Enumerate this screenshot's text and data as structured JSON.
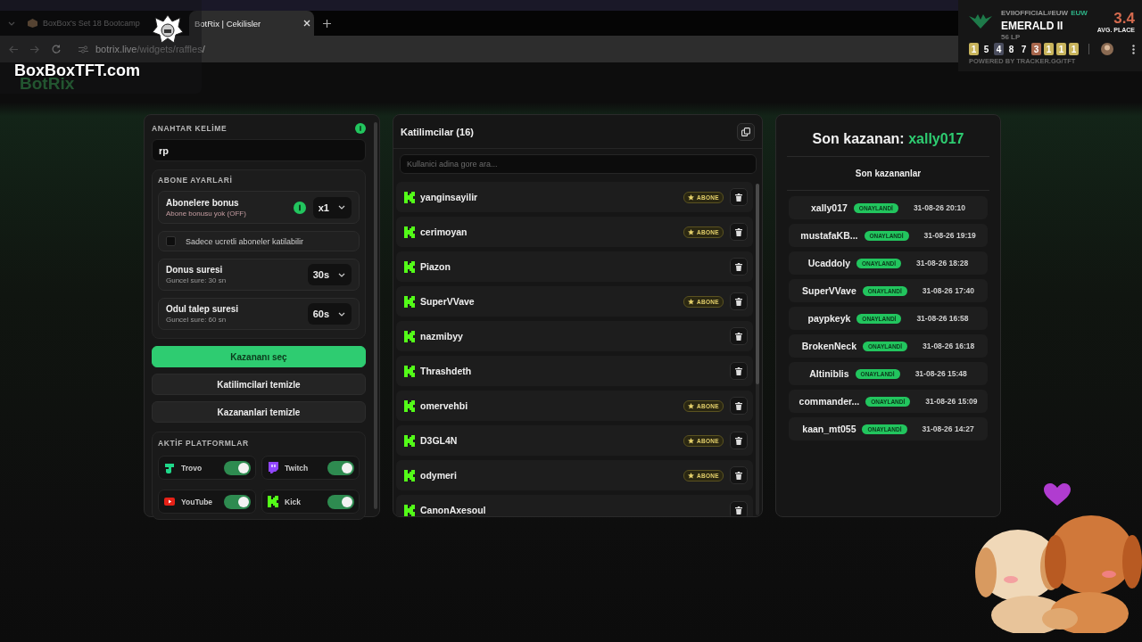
{
  "browser": {
    "tabs": [
      {
        "title": "BoxBox's Set 18 Bootcamp",
        "selected": false
      },
      {
        "title": "BotRix | Cekilisler",
        "selected": true
      }
    ],
    "url_host": "botrix.live",
    "url_path": "/widgets/raffles/"
  },
  "stream_overlay": {
    "site": "BoxBoxTFT.com"
  },
  "rank_widget": {
    "player": "EVIIOFFICIAL#EUW",
    "region": "EUW",
    "rank": "EMERALD II",
    "lp": "56 LP",
    "avg": "3.4",
    "avg_label": "AVG. PLACE",
    "powered_by": "POWERED BY TRACKER.GG/TFT",
    "placements": [
      {
        "value": "1",
        "color": "#c8b45c"
      },
      {
        "value": "5"
      },
      {
        "value": "4",
        "color": "#4a4d5e"
      },
      {
        "value": "8"
      },
      {
        "value": "7"
      },
      {
        "value": "3",
        "color": "#a8664c"
      },
      {
        "value": "1",
        "color": "#c8b45c"
      },
      {
        "value": "1",
        "color": "#c8b45c"
      },
      {
        "value": "1",
        "color": "#c8b45c"
      }
    ]
  },
  "app": {
    "logo": "BotRix"
  },
  "settings": {
    "keyword": {
      "label": "ANAHTAR KELİME",
      "value": "rp"
    },
    "subscriber": {
      "title": "ABONE AYARLARİ",
      "bonus": {
        "label": "Abonelere bonus",
        "hint": "Abone bonusu yok (OFF)",
        "value": "x1"
      },
      "paid_only": {
        "label": "Sadece ucretli aboneler katilabilir",
        "checked": false
      },
      "timers": [
        {
          "label": "Donus suresi",
          "hint": "Guncel sure: 30 sn",
          "value": "30s"
        },
        {
          "label": "Odul talep suresi",
          "hint": "Guncel sure: 60 sn",
          "value": "60s"
        }
      ]
    },
    "buttons": [
      {
        "label": "Kazananı seç",
        "kind": "primary"
      },
      {
        "label": "Katilimcilari temizle",
        "kind": "secondary"
      },
      {
        "label": "Kazananlari temizle",
        "kind": "secondary"
      }
    ],
    "platforms": {
      "title": "AKTİF PLATFORMLAR",
      "items": [
        {
          "kind": "trovo",
          "name": "Trovo",
          "on": true
        },
        {
          "kind": "twitch",
          "name": "Twitch",
          "on": true
        },
        {
          "kind": "youtube",
          "name": "YouTube",
          "on": true
        },
        {
          "kind": "kick",
          "name": "Kick",
          "on": true
        }
      ]
    }
  },
  "participants": {
    "title": "Katilimcilar (16)",
    "search_placeholder": "Kullanici adina gore ara...",
    "rows": [
      {
        "name": "yanginsayilir",
        "badge": "ABONE"
      },
      {
        "name": "cerimoyan",
        "badge": "ABONE"
      },
      {
        "name": "Piazon"
      },
      {
        "name": "SuperVVave",
        "badge": "ABONE"
      },
      {
        "name": "nazmibyy"
      },
      {
        "name": "Thrashdeth"
      },
      {
        "name": "omervehbi",
        "badge": "ABONE"
      },
      {
        "name": "D3GL4N",
        "badge": "ABONE"
      },
      {
        "name": "odymeri",
        "badge": "ABONE"
      },
      {
        "name": "CanonAxesoul"
      }
    ]
  },
  "winners": {
    "title": "Son kazanan:",
    "last_winner": "xally017",
    "subtitle": "Son kazananlar",
    "rows": [
      {
        "name": "xally017",
        "status": "ONAYLANDİ",
        "date": "31-08-26 20:10"
      },
      {
        "name": "mustafaKB...",
        "status": "ONAYLANDİ",
        "date": "31-08-26 19:19"
      },
      {
        "name": "Ucaddoly",
        "status": "ONAYLANDİ",
        "date": "31-08-26 18:28"
      },
      {
        "name": "SuperVVave",
        "status": "ONAYLANDİ",
        "date": "31-08-26 17:40"
      },
      {
        "name": "paypkeyk",
        "status": "ONAYLANDİ",
        "date": "31-08-26 16:58"
      },
      {
        "name": "BrokenNeck",
        "status": "ONAYLANDİ",
        "date": "31-08-26 16:18"
      },
      {
        "name": "Altiniblis",
        "status": "ONAYLANDİ",
        "date": "31-08-26 15:48"
      },
      {
        "name": "commander...",
        "status": "ONAYLANDİ",
        "date": "31-08-26 15:09"
      },
      {
        "name": "kaan_mt055",
        "status": "ONAYLANDİ",
        "date": "31-08-26 14:27"
      }
    ]
  }
}
